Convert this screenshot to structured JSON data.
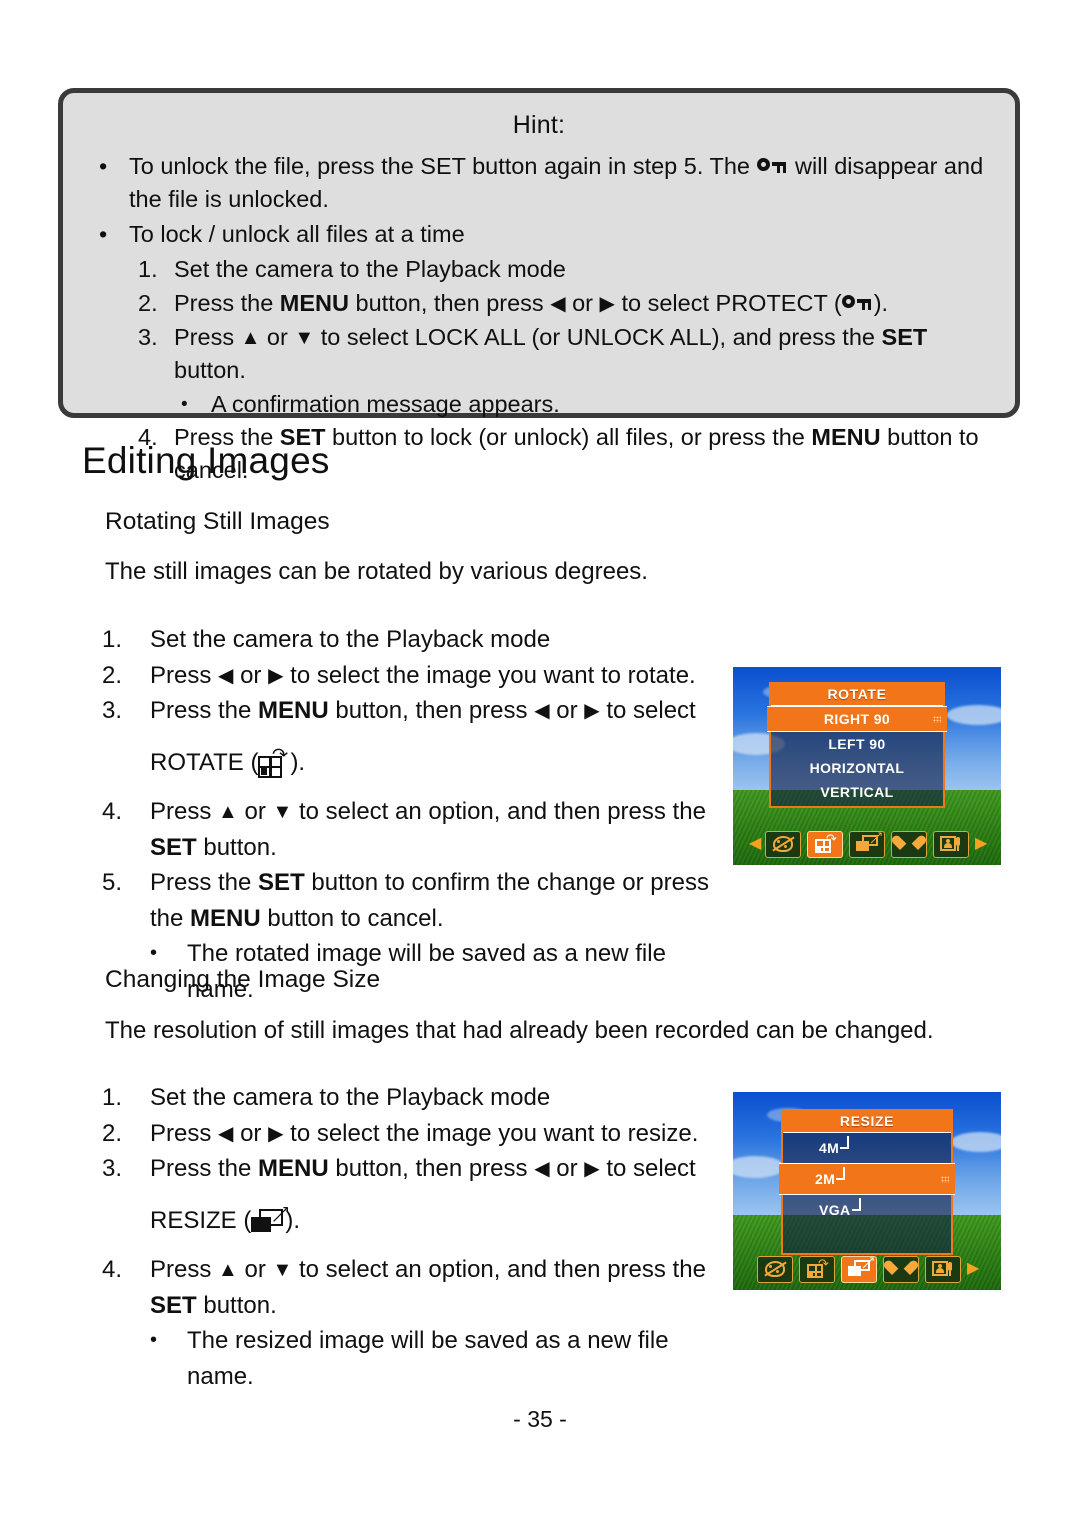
{
  "document": {
    "page_number": "- 35 -"
  },
  "hint": {
    "title": "Hint:",
    "bullets": [
      {
        "text_before": "To unlock the file, press the SET button again in step 5. The",
        "icon": "key-lock-icon",
        "text_after": "will disappear and the file is unlocked."
      },
      {
        "text": "To lock / unlock all files at a time"
      }
    ],
    "steps": [
      {
        "num": "1.",
        "text": "Set the camera to the Playback mode"
      },
      {
        "num": "2.",
        "text_parts": [
          "Press the ",
          "MENU",
          " button, then press ",
          "◀",
          " or ",
          "▶",
          " to select ",
          "PROTECT",
          " ("
        ],
        "icon": "key-lock-icon",
        "text_end": ")."
      },
      {
        "num": "3.",
        "text_parts": [
          "Press ",
          "▲",
          " or ",
          "▼",
          " to select ",
          "LOCK ALL",
          " (or ",
          "UNLOCK ALL",
          "), and press the ",
          "SET",
          " button."
        ],
        "sub_bullet": "A confirmation message appears."
      },
      {
        "num": "4.",
        "text_parts": [
          "Press the ",
          "SET",
          " button to lock (or unlock) all files, or press the ",
          "MENU",
          " button to cancel."
        ]
      }
    ]
  },
  "section": {
    "title": "Editing Images"
  },
  "rotating": {
    "heading": "Rotating Still Images",
    "intro": "The still images can be rotated by various degrees.",
    "steps": [
      {
        "num": "1.",
        "text": "Set the camera to the Playback mode"
      },
      {
        "num": "2.",
        "text_a": "Press ",
        "arrow_left": "◀",
        "text_b": " or ",
        "arrow_right": "▶",
        "text_c": " to select the image you want to rotate."
      },
      {
        "num": "3.",
        "text_a": "Press the ",
        "bold1": "MENU",
        "text_b": " button, then press ",
        "arrow_left": "◀",
        "text_c": " or ",
        "arrow_right": "▶",
        "text_d": " to select"
      },
      {
        "label": "ROTATE (",
        "icon": "rotate-icon",
        "label_end": ")."
      },
      {
        "num": "4.",
        "text_a": "Press ",
        "arrow_up": "▲",
        "text_b": " or ",
        "arrow_down": "▼",
        "text_c": " to select an option, and then press the ",
        "bold1": "SET",
        "text_d": " button."
      },
      {
        "num": "5.",
        "text_a": "Press the ",
        "bold1": "SET",
        "text_b": " button to confirm the change or press the ",
        "bold2": "MENU",
        "text_c": " button to cancel."
      },
      {
        "bullet": "The rotated image will be saved as a new file name."
      }
    ]
  },
  "resizing": {
    "heading": "Changing the Image Size",
    "intro": "The resolution of still images that had already been recorded can be changed.",
    "steps": [
      {
        "num": "1.",
        "text": "Set the camera to the Playback mode"
      },
      {
        "num": "2.",
        "text_a": "Press ",
        "arrow_left": "◀",
        "text_b": " or ",
        "arrow_right": "▶",
        "text_c": " to select the image you want to resize."
      },
      {
        "num": "3.",
        "text_a": "Press the ",
        "bold1": "MENU",
        "text_b": " button, then press ",
        "arrow_left": "◀",
        "text_c": " or ",
        "arrow_right": "▶",
        "text_d": " to select"
      },
      {
        "label": "RESIZE (",
        "icon": "resize-icon",
        "label_end": ")."
      },
      {
        "num": "4.",
        "text_a": "Press ",
        "arrow_up": "▲",
        "text_b": " or ",
        "arrow_down": "▼",
        "text_c": " to select an option, and then press the ",
        "bold1": "SET",
        "text_d": " button."
      },
      {
        "bullet": "The resized image will be saved as a new file name."
      }
    ]
  },
  "camera_rotate_screen": {
    "menu_title": "ROTATE",
    "options": [
      "RIGHT 90",
      "LEFT 90",
      "HORIZONTAL",
      "VERTICAL"
    ],
    "selected_index": 0,
    "toolbar_icons": [
      "effect-icon",
      "rotate-icon",
      "resize-icon",
      "heart-icon",
      "voice-memo-icon"
    ],
    "toolbar_active_index": 1,
    "has_left_arrow": true,
    "has_right_arrow": true,
    "accent_color": "#f2751a"
  },
  "camera_resize_screen": {
    "menu_title": "RESIZE",
    "options": [
      "4M",
      "2M",
      "VGA"
    ],
    "selected_index": 1,
    "toolbar_icons": [
      "effect-icon",
      "rotate-icon",
      "resize-icon",
      "heart-icon",
      "voice-memo-icon"
    ],
    "toolbar_active_index": 2,
    "has_left_arrow": false,
    "has_right_arrow": true,
    "accent_color": "#f2751a"
  }
}
